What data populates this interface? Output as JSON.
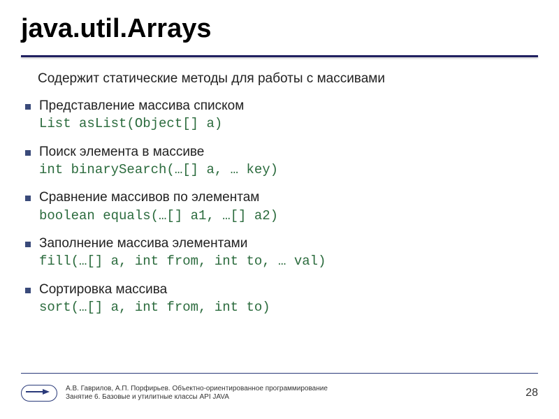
{
  "title": "java.util.Arrays",
  "intro": "Содержит статические методы для работы с массивами",
  "items": [
    {
      "desc": "Представление массива списком",
      "code": "List asList(Object[] a)"
    },
    {
      "desc": "Поиск элемента в массиве",
      "code": "int binarySearch(…[] a, … key)"
    },
    {
      "desc": "Сравнение массивов по элементам",
      "code": "boolean equals(…[] a1, …[] a2)"
    },
    {
      "desc": "Заполнение массива элементами",
      "code": "fill(…[] a, int from, int to, … val)"
    },
    {
      "desc": "Сортировка массива",
      "code": "sort(…[] a, int from, int to)"
    }
  ],
  "footer": {
    "line1": "А.В. Гаврилов, А.П. Порфирьев. Объектно-ориентированное программирование",
    "line2": "Занятие 6. Базовые и утилитные классы API JAVA"
  },
  "page": "28"
}
